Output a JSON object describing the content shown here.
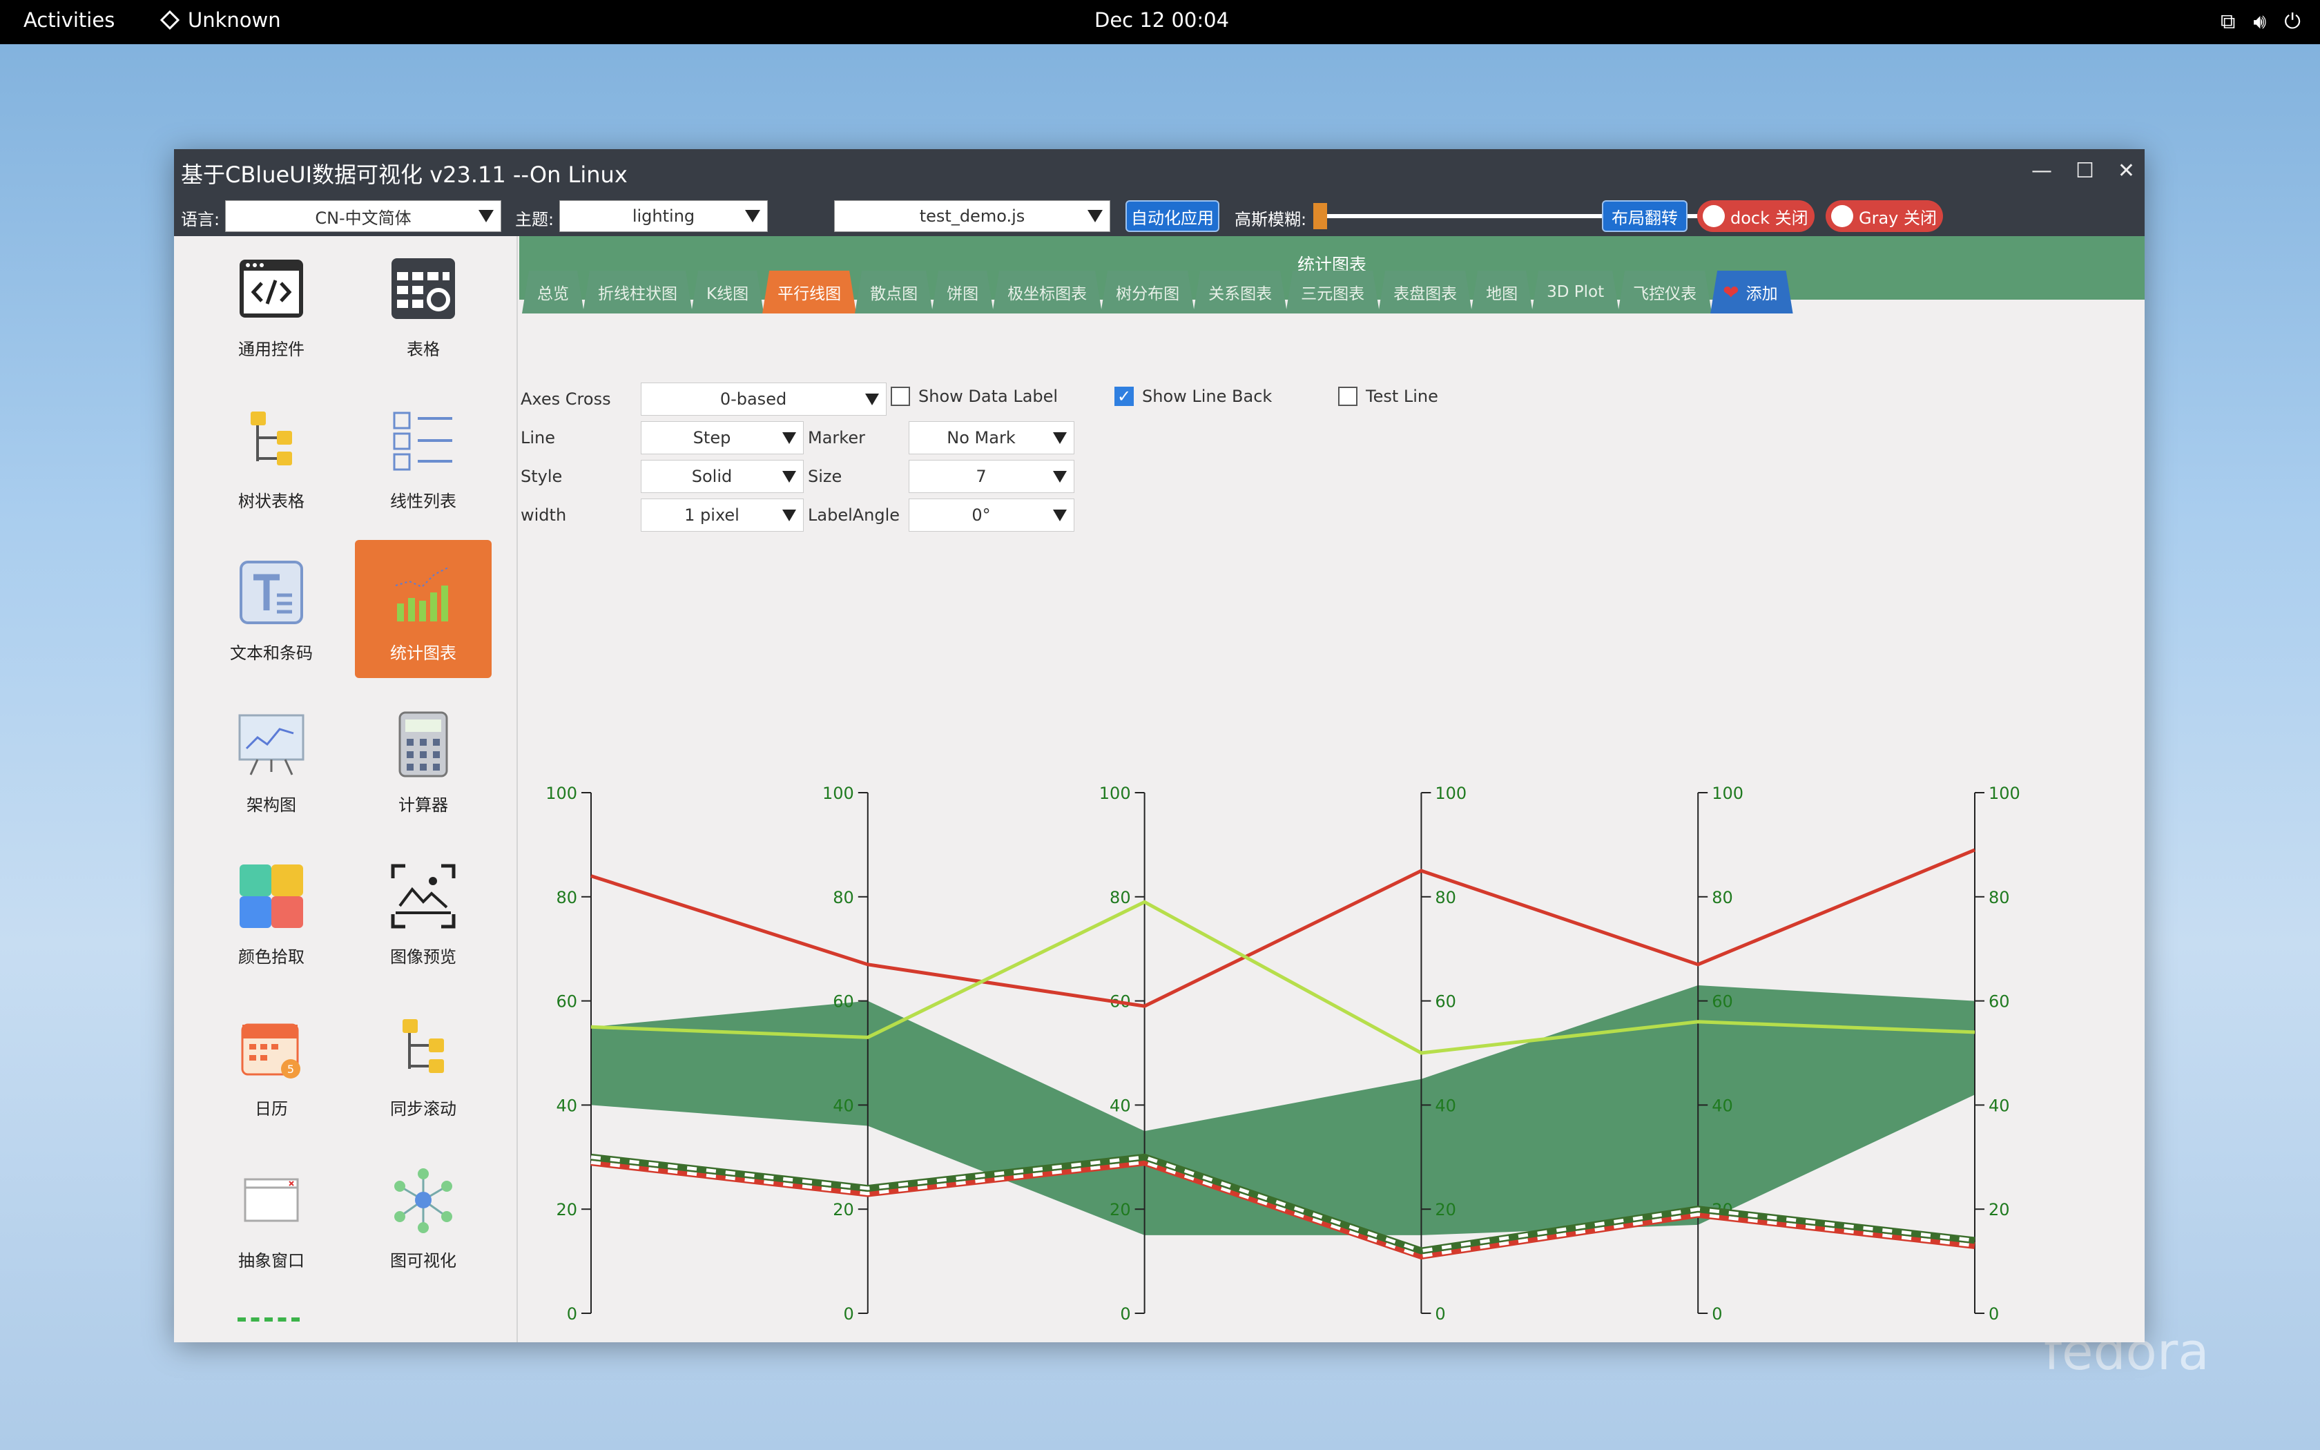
{
  "topbar": {
    "activities": "Activities",
    "app": "Unknown",
    "clock": "Dec 12  00:04"
  },
  "window": {
    "title": "基于CBlueUI数据可视化 v23.11 --On Linux",
    "lang_label": "语言:",
    "lang_value": "CN-中文简体",
    "theme_label": "主题:",
    "theme_value": "lighting",
    "script_value": "test_demo.js",
    "auto_btn": "自动化应用",
    "blur_label": "高斯模糊:",
    "layout_btn": "布局翻转",
    "dock_btn": "dock 关闭",
    "gray_btn": "Gray 关闭"
  },
  "sidebar": {
    "items": [
      {
        "label": "通用控件",
        "icon": "code-window-icon"
      },
      {
        "label": "表格",
        "icon": "table-gear-icon"
      },
      {
        "label": "树状表格",
        "icon": "tree-table-icon"
      },
      {
        "label": "线性列表",
        "icon": "linear-list-icon"
      },
      {
        "label": "文本和条码",
        "icon": "text-icon"
      },
      {
        "label": "统计图表",
        "icon": "bar-chart-icon"
      },
      {
        "label": "架构图",
        "icon": "presentation-board-icon"
      },
      {
        "label": "计算器",
        "icon": "calculator-icon"
      },
      {
        "label": "颜色拾取",
        "icon": "color-picker-icon"
      },
      {
        "label": "图像预览",
        "icon": "image-preview-icon"
      },
      {
        "label": "日历",
        "icon": "calendar-icon"
      },
      {
        "label": "同步滚动",
        "icon": "sync-scroll-icon"
      },
      {
        "label": "抽象窗口",
        "icon": "abstract-window-icon"
      },
      {
        "label": "图可视化",
        "icon": "graph-network-icon"
      }
    ]
  },
  "content": {
    "header": "统计图表",
    "tabs": [
      "总览",
      "折线柱状图",
      "K线图",
      "平行线图",
      "散点图",
      "饼图",
      "极坐标图表",
      "树分布图",
      "关系图表",
      "三元图表",
      "表盘图表",
      "地图",
      "3D Plot",
      "飞控仪表"
    ],
    "add_tab": "添加",
    "controls": {
      "axes_cross_label": "Axes Cross",
      "axes_cross_value": "0-based",
      "show_data_label": "Show Data Label",
      "show_line_back": "Show Line Back",
      "test_line": "Test Line",
      "line_label": "Line",
      "line_value": "Step",
      "marker_label": "Marker",
      "marker_value": "No Mark",
      "style_label": "Style",
      "style_value": "Solid",
      "size_label": "Size",
      "size_value": "7",
      "width_label": "width",
      "width_value": "1 pixel",
      "label_angle_label": "LabelAngle",
      "label_angle_value": "0°"
    }
  },
  "colors": {
    "accent": "#e97635",
    "green": "#3f8a59",
    "header": "#5b9b72",
    "red_line": "#d43a2c",
    "lime_line": "#b6de4b"
  },
  "chart_data": {
    "type": "parallel",
    "axes_count": 6,
    "ylim": [
      0,
      100
    ],
    "ticks": [
      0,
      20,
      40,
      60,
      80,
      100
    ],
    "band": {
      "upper": [
        55,
        60,
        35,
        45,
        63,
        60
      ],
      "lower": [
        40,
        36,
        15,
        15,
        17,
        42
      ]
    },
    "series": [
      {
        "values": [
          84,
          67,
          59,
          85,
          67,
          89
        ],
        "color": "#d43a2c",
        "style": "solid"
      },
      {
        "values": [
          55,
          53,
          79,
          50,
          56,
          54
        ],
        "color": "#b6de4b",
        "style": "solid"
      },
      {
        "values": [
          29,
          23,
          29,
          11,
          19,
          13
        ],
        "color": "#d43a2c",
        "style": "dashed-white"
      },
      {
        "values": [
          30,
          24,
          30,
          12,
          20,
          14
        ],
        "color": "#3b6e2c",
        "style": "dashed-white"
      }
    ]
  }
}
